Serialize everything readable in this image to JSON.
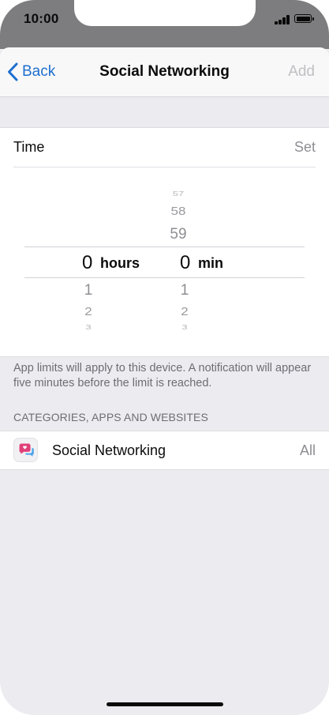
{
  "status_bar": {
    "time": "10:00"
  },
  "nav": {
    "back_label": "Back",
    "title": "Social Networking",
    "add_label": "Add"
  },
  "time_section": {
    "label": "Time",
    "value": "Set",
    "picker": {
      "hours_selected": "0",
      "hours_unit": "hours",
      "minutes_selected": "0",
      "minutes_unit": "min",
      "minutes_above": [
        "57",
        "58",
        "59"
      ],
      "hours_below": [
        "1",
        "2",
        "3"
      ],
      "minutes_below": [
        "1",
        "2",
        "3"
      ]
    }
  },
  "note": "App limits will apply to this device. A notification will appear five minutes before the limit is reached.",
  "categories_header": "CATEGORIES, APPS AND WEBSITES",
  "category": {
    "label": "Social Networking",
    "value": "All",
    "icon": "social-networking-icon"
  },
  "colors": {
    "accent": "#1e6fd0",
    "icon_pink": "#e0407a",
    "icon_blue": "#4aa3e8"
  }
}
